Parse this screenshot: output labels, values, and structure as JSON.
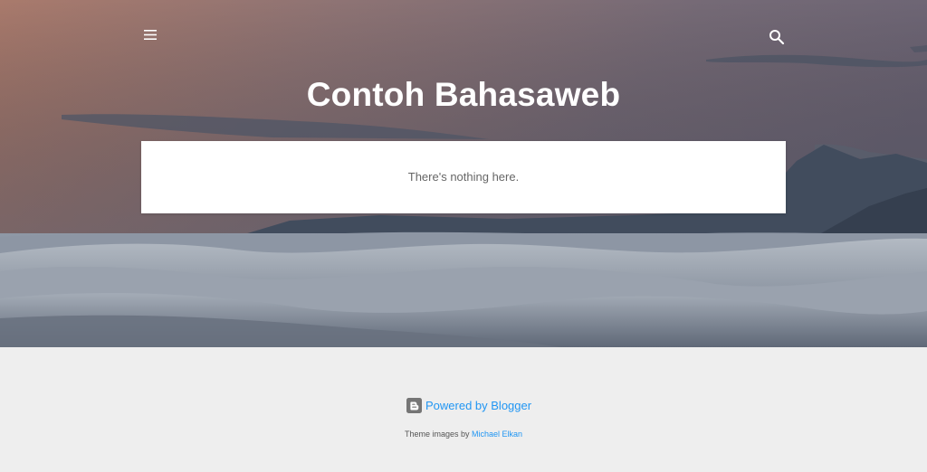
{
  "header": {
    "blog_title": "Contoh Bahasaweb",
    "menu_icon": "hamburger-menu-icon",
    "search_icon": "search-icon"
  },
  "main": {
    "empty_message": "There's nothing here."
  },
  "footer": {
    "powered_by_label": "Powered by Blogger",
    "blogger_icon": "blogger-logo-icon",
    "attribution_prefix": "Theme images by",
    "attribution_author": "Michael Elkan"
  },
  "colors": {
    "link": "#2196f3",
    "footer_bg": "#eeeeee",
    "title_text": "#ffffff"
  }
}
